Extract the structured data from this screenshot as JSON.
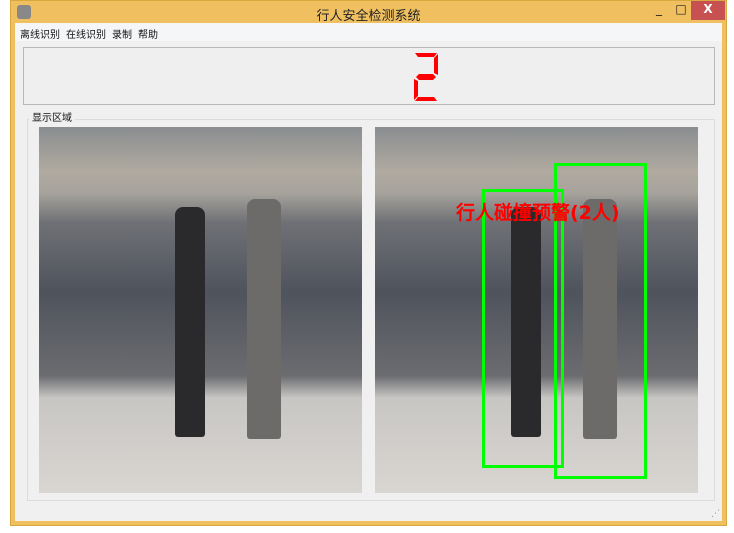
{
  "window": {
    "title": "行人安全检测系统",
    "minimize": "_",
    "maximize": "□",
    "close": "X"
  },
  "menu": [
    {
      "label": "离线识别"
    },
    {
      "label": "在线识别"
    },
    {
      "label": "录制"
    },
    {
      "label": "帮助"
    }
  ],
  "counter": {
    "value": "2",
    "color": "#ff0000"
  },
  "display_group": {
    "label": "显示区域"
  },
  "result": {
    "warning_text": "行人碰撞预警(2人)",
    "box_color": "#00ff00",
    "detections": 2
  }
}
